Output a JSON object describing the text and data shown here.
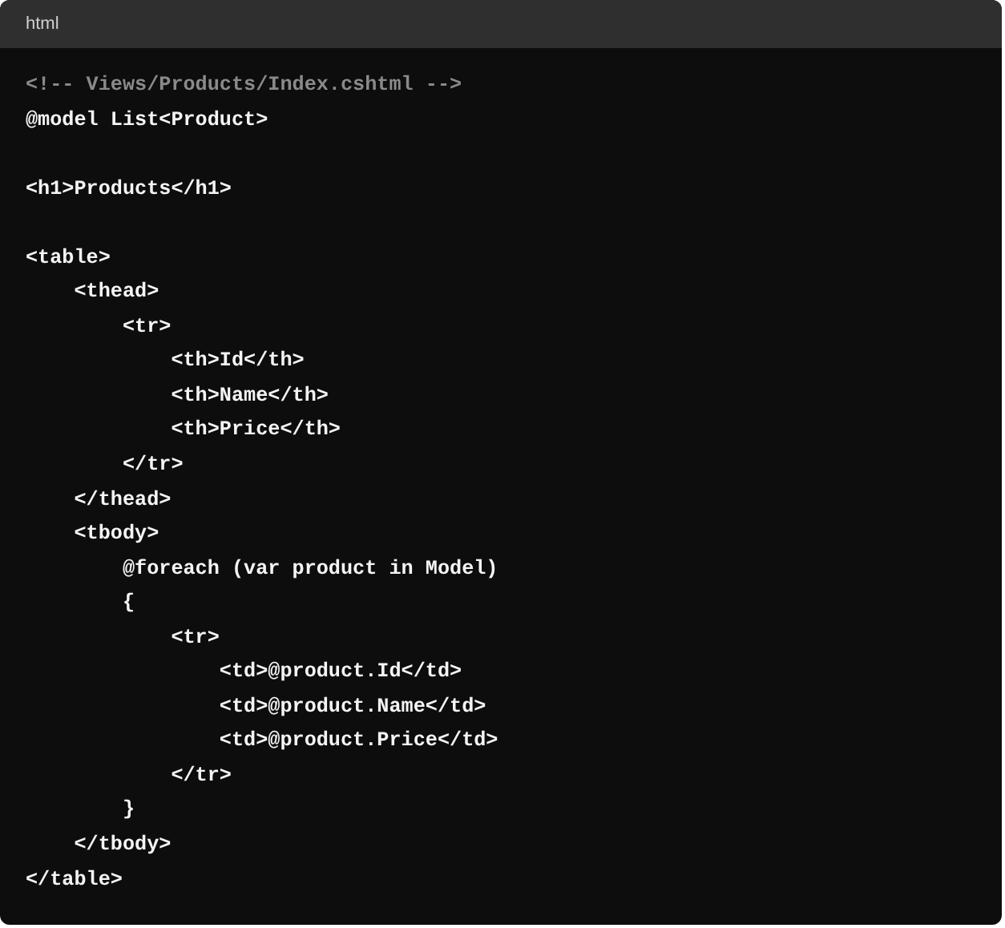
{
  "code_block": {
    "language": "html",
    "lines": [
      {
        "kind": "comment",
        "text": "<!-- Views/Products/Index.cshtml -->"
      },
      {
        "kind": "code",
        "text": "@model List<Product>"
      },
      {
        "kind": "blank"
      },
      {
        "kind": "code",
        "text": "<h1>Products</h1>"
      },
      {
        "kind": "blank"
      },
      {
        "kind": "code",
        "text": "<table>"
      },
      {
        "kind": "code",
        "text": "    <thead>"
      },
      {
        "kind": "code",
        "text": "        <tr>"
      },
      {
        "kind": "code",
        "text": "            <th>Id</th>"
      },
      {
        "kind": "code",
        "text": "            <th>Name</th>"
      },
      {
        "kind": "code",
        "text": "            <th>Price</th>"
      },
      {
        "kind": "code",
        "text": "        </tr>"
      },
      {
        "kind": "code",
        "text": "    </thead>"
      },
      {
        "kind": "code",
        "text": "    <tbody>"
      },
      {
        "kind": "code",
        "text": "        @foreach (var product in Model)"
      },
      {
        "kind": "code",
        "text": "        {"
      },
      {
        "kind": "code",
        "text": "            <tr>"
      },
      {
        "kind": "code",
        "text": "                <td>@product.Id</td>"
      },
      {
        "kind": "code",
        "text": "                <td>@product.Name</td>"
      },
      {
        "kind": "code",
        "text": "                <td>@product.Price</td>"
      },
      {
        "kind": "code",
        "text": "            </tr>"
      },
      {
        "kind": "code",
        "text": "        }"
      },
      {
        "kind": "code",
        "text": "    </tbody>"
      },
      {
        "kind": "code",
        "text": "</table>"
      }
    ]
  }
}
